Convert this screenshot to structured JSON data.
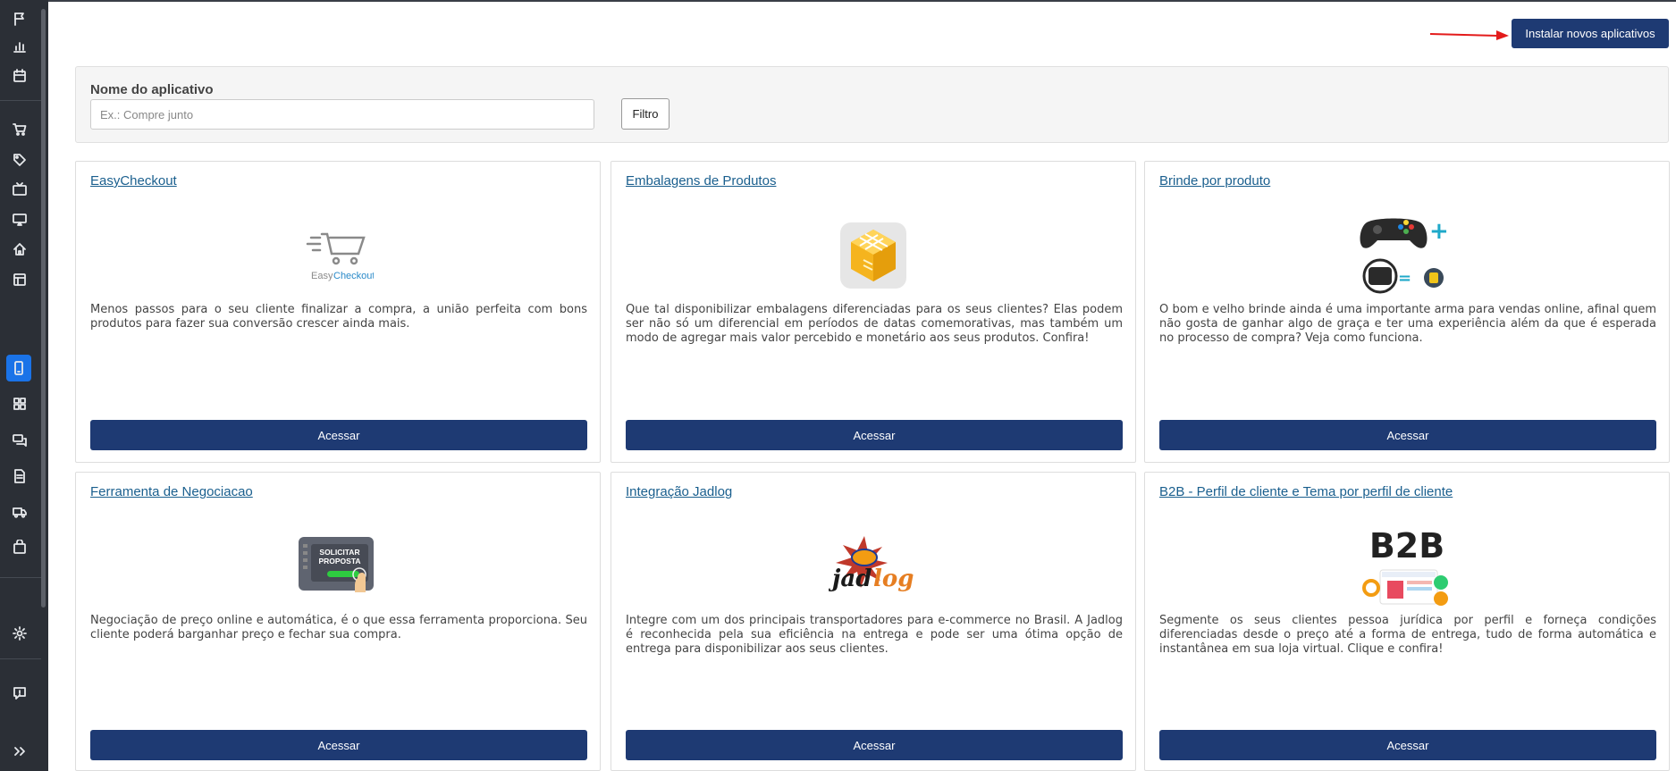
{
  "sidebar": {
    "items": [
      {
        "icon": "flag-icon"
      },
      {
        "icon": "bar-chart-icon"
      },
      {
        "icon": "calendar-icon"
      },
      {
        "icon": "cart-icon"
      },
      {
        "icon": "tag-icon"
      },
      {
        "icon": "tv-icon"
      },
      {
        "icon": "monitor-icon"
      },
      {
        "icon": "home-icon"
      },
      {
        "icon": "layout-icon"
      },
      {
        "icon": "mobile-icon",
        "active": true
      },
      {
        "icon": "grid-icon"
      },
      {
        "icon": "chat-icon"
      },
      {
        "icon": "document-icon"
      },
      {
        "icon": "truck-icon"
      },
      {
        "icon": "bag-icon"
      },
      {
        "icon": "gear-icon"
      },
      {
        "icon": "feedback-icon"
      },
      {
        "icon": "double-chevron-right-icon"
      }
    ],
    "active_color": "#1a73e8"
  },
  "header": {
    "install_label": "Instalar novos aplicativos"
  },
  "filter": {
    "label": "Nome do aplicativo",
    "placeholder": "Ex.: Compre junto",
    "value": "",
    "button_label": "Filtro"
  },
  "apps": [
    {
      "title": "EasyCheckout",
      "logo": "easycheckout-logo",
      "logo_text_1": "Easy",
      "logo_text_2": "Checkout",
      "description": "Menos passos para o seu cliente finalizar a compra, a união perfeita com bons produtos para fazer sua conversão crescer ainda mais.",
      "button_label": "Acessar"
    },
    {
      "title": "Embalagens de Produtos",
      "logo": "package-box-logo",
      "description": "Que tal disponibilizar embalagens diferenciadas para os seus clientes? Elas podem ser não só um diferencial em períodos de datas comemorativas, mas também um modo de agregar mais valor percebido e monetário aos seus produtos. Confira!",
      "button_label": "Acessar"
    },
    {
      "title": "Brinde por produto",
      "logo": "gift-gamepad-logo",
      "description": "O bom e velho brinde ainda é uma importante arma para vendas online, afinal quem não gosta de ganhar algo de graça e ter uma experiência além da que é esperada no processo de compra? Veja como funciona.",
      "button_label": "Acessar"
    },
    {
      "title": "Ferramenta de Negociacao",
      "logo": "solicitar-proposta-logo",
      "logo_text": "SOLICITAR PROPOSTA",
      "description": "Negociação de preço online e automática, é o que essa ferramenta proporciona. Seu cliente poderá barganhar preço e fechar sua compra.",
      "button_label": "Acessar"
    },
    {
      "title": "Integração Jadlog",
      "logo": "jadlog-logo",
      "logo_text": "Jadlog",
      "description": "Integre com um dos principais transportadores para e-commerce no Brasil. A Jadlog é reconhecida pela sua eficiência na entrega e pode ser uma ótima opção de entrega para disponibilizar aos seus clientes.",
      "button_label": "Acessar"
    },
    {
      "title": "B2B - Perfil de cliente e Tema por perfil de cliente",
      "logo": "b2b-logo",
      "logo_text": "B2B",
      "description": "Segmente os seus clientes pessoa jurídica por perfil e forneça condições diferenciadas desde o preço até a forma de entrega, tudo de forma automática e instantânea em sua loja virtual. Clique e confira!",
      "button_label": "Acessar"
    }
  ],
  "colors": {
    "primary_button": "#1e3a73",
    "link": "#1a5f8e",
    "sidebar_bg": "#2b2f36",
    "annotation_arrow": "#e31b1b"
  }
}
